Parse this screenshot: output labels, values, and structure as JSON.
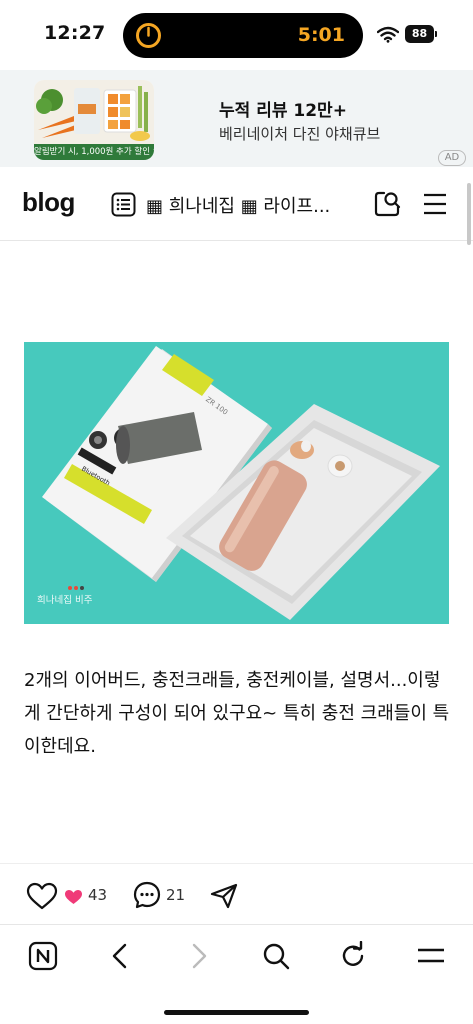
{
  "status_bar": {
    "time": "12:27",
    "timer": "5:01",
    "battery": "88"
  },
  "ad": {
    "thumb_cta": "알림받기 시, 1,000원 추가 할인 >",
    "title": "누적 리뷰 12만+",
    "subtitle": "베리네이처 다진 야채큐브",
    "badge": "AD"
  },
  "header": {
    "logo": "blog",
    "nav_text": "▦ 희나네집 ▦ 라이프..."
  },
  "photo": {
    "box_label": "ZR 100",
    "box_tag": "Bluetooth",
    "watermark": "희나네집 비주",
    "colors": {
      "background": "#47c9bd",
      "box": "#f2f2f2",
      "case": "#d9a48f",
      "accent": "#d9e02a"
    }
  },
  "post": {
    "body": "2개의 이어버드, 충전크래들, 충전케이블, 설명서...이렇게 간단하게 구성이 되어 있구요~ 특히 충전 크래들이 특이한데요."
  },
  "reactions": {
    "likes": "43",
    "comments": "21"
  },
  "icons": {
    "list": "list-icon",
    "search": "search-icon",
    "menu": "menu-icon",
    "like": "heart-icon",
    "comment": "comment-icon",
    "share": "share-icon",
    "toolbar": [
      "naver-home-icon",
      "back-icon",
      "forward-icon",
      "search-icon",
      "refresh-icon",
      "menu-icon"
    ]
  }
}
